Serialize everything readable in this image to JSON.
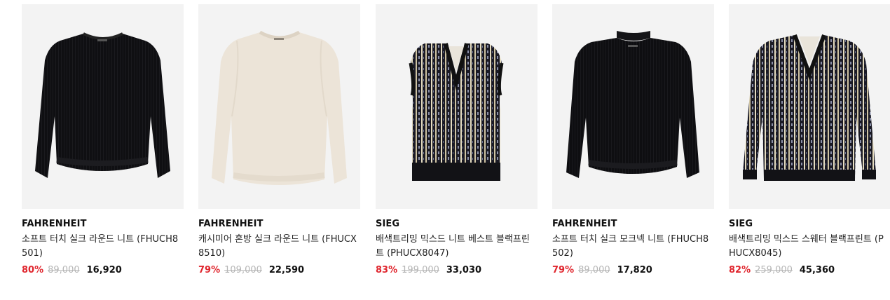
{
  "products": [
    {
      "brand": "FAHRENHEIT",
      "name": "소프트 터치 실크 라운드 니트 (FHUCH8501)",
      "discount": "80%",
      "original_price": "89,000",
      "sale_price": "16,920",
      "image": "black-crewneck-sweater"
    },
    {
      "brand": "FAHRENHEIT",
      "name": "캐시미어 혼방 실크 라운드 니트 (FHUCX8510)",
      "discount": "79%",
      "original_price": "109,000",
      "sale_price": "22,590",
      "image": "ivory-crewneck-sweater"
    },
    {
      "brand": "SIEG",
      "name": "배색트리밍 믹스드 니트 베스트 블랙프린트 (PHUCX8047)",
      "discount": "83%",
      "original_price": "199,000",
      "sale_price": "33,030",
      "image": "patterned-knit-vest"
    },
    {
      "brand": "FAHRENHEIT",
      "name": "소프트 터치 실크 모크넥 니트 (FHUCH8502)",
      "discount": "79%",
      "original_price": "89,000",
      "sale_price": "17,820",
      "image": "black-mockneck-sweater"
    },
    {
      "brand": "SIEG",
      "name": "배색트리밍 믹스드 스웨터 블랙프린트 (PHUCX8045)",
      "discount": "82%",
      "original_price": "259,000",
      "sale_price": "45,360",
      "image": "patterned-vneck-sweater"
    }
  ],
  "colors": {
    "discount": "#e0262e",
    "original_price": "#b5b5b5",
    "thumb_bg": "#f3f3f3"
  }
}
